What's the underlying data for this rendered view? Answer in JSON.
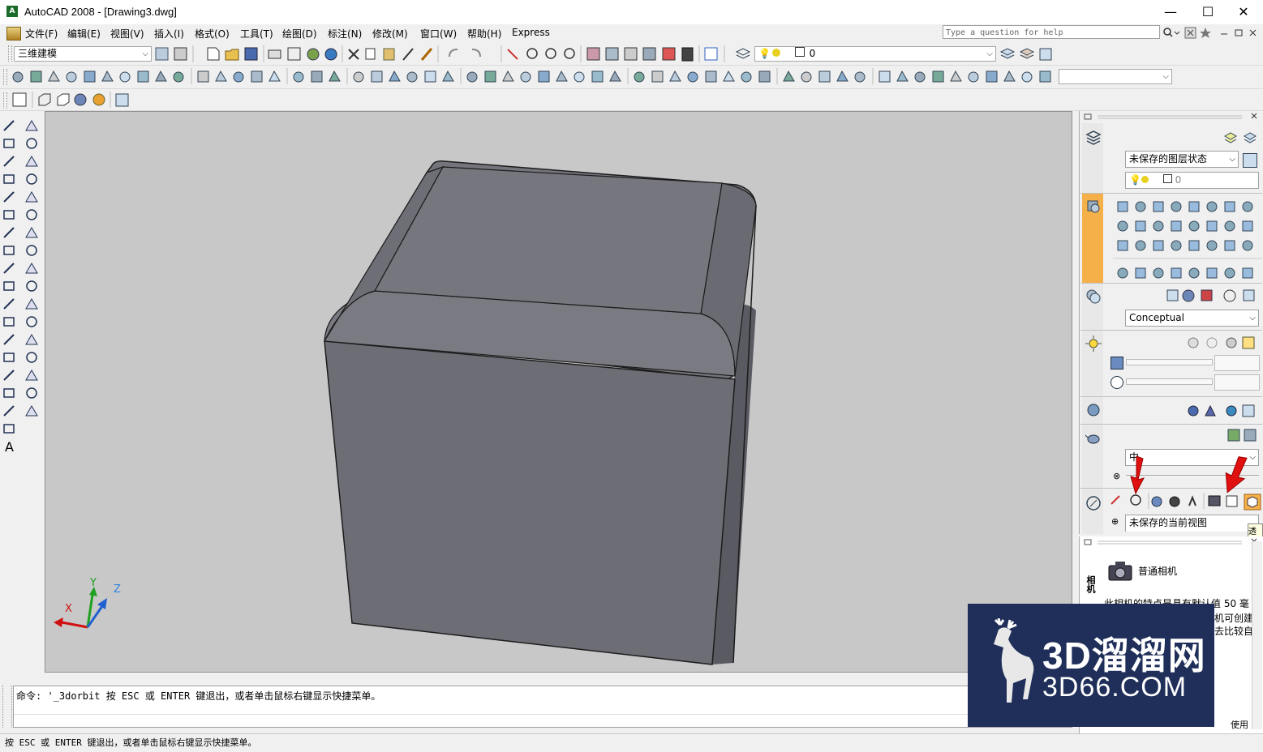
{
  "window": {
    "title": "AutoCAD 2008 - [Drawing3.dwg]",
    "app_icon_text": "A",
    "minimize": "—",
    "maximize": "☐",
    "close": "✕"
  },
  "menu": {
    "items": [
      "文件(F)",
      "编辑(E)",
      "视图(V)",
      "插入(I)",
      "格式(O)",
      "工具(T)",
      "绘图(D)",
      "标注(N)",
      "修改(M)",
      "窗口(W)",
      "帮助(H)",
      "Express"
    ],
    "help_placeholder": "Type a question for help"
  },
  "toolbar": {
    "workspace": "三维建模",
    "layer_value": "0"
  },
  "palette": {
    "layer_state": "未保存的图层状态",
    "layer_name": "0",
    "visual_style": "Conceptual",
    "light_quality": "中",
    "view_name": "未保存的当前视图",
    "tooltip_peek": "透"
  },
  "tool_palette": {
    "tab_label": "相机",
    "camera_title": "普通相机",
    "desc_line1": "此相机的特点是具有默认值 50 毫",
    "desc_line2": "机可创建",
    "desc_line3": "去比较自",
    "footer": "使用"
  },
  "ucs": {
    "x": "X",
    "y": "Y",
    "z": "Z"
  },
  "command": {
    "history": "命令: '_3dorbit 按 ESC 或 ENTER 键退出，或者单击鼠标右键显示快捷菜单。",
    "input": ""
  },
  "status": {
    "text": "按 ESC 或 ENTER 键退出，或者单击鼠标右键显示快捷菜单。"
  },
  "watermark": {
    "brand": "3D溜溜网",
    "domain": "3D66.COM"
  },
  "colors": {
    "viewport_bg": "#c8c8c8",
    "cube_front": "#6d6d76",
    "cube_top": "#74747c",
    "accent_orange": "#f5b04a",
    "arrow_red": "#e01010",
    "watermark_bg": "#1f2f5a"
  }
}
